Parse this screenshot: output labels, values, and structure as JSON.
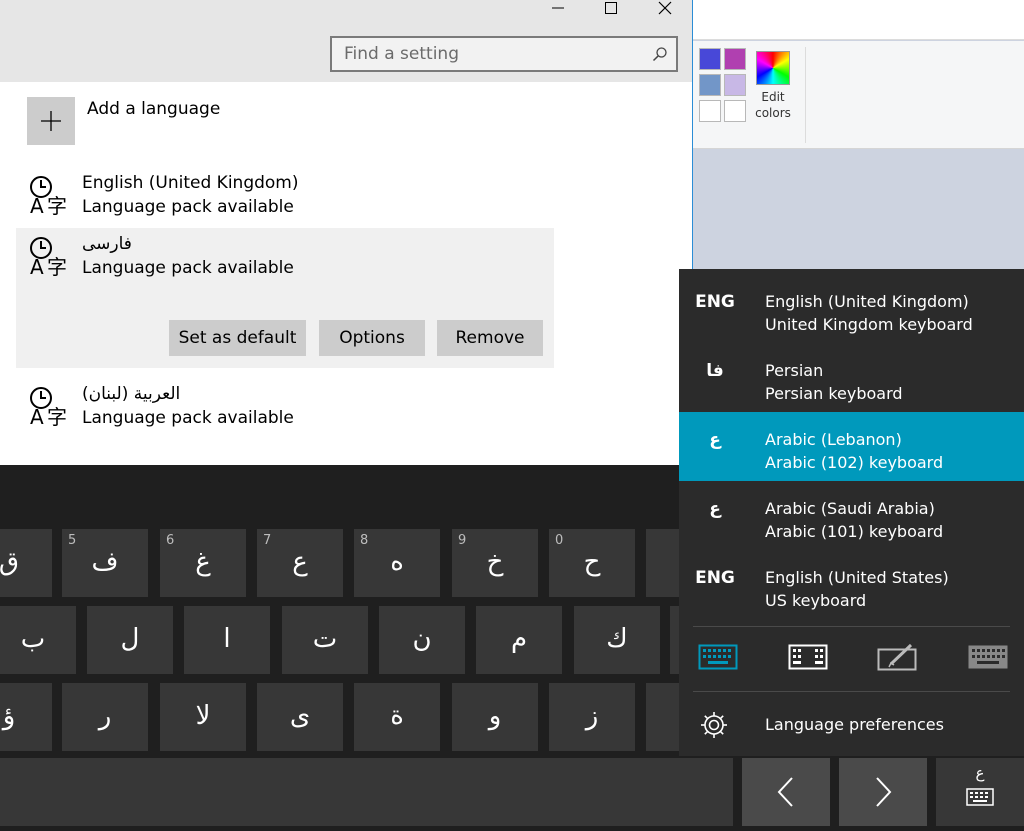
{
  "paint": {
    "edit_colors_label": "Edit colors",
    "swatch_colors": [
      "#4848d8",
      "#b040b0",
      "#7296c8",
      "#c8b8e6",
      "#ffffff",
      "#ffffff"
    ]
  },
  "settings": {
    "search": {
      "placeholder": "Find a setting"
    },
    "add_language_label": "Add a language",
    "languages": [
      {
        "name": "English (United Kingdom)",
        "status": "Language pack available"
      },
      {
        "name": "فارسی",
        "status": "Language pack available"
      },
      {
        "name": "العربية (لبنان)",
        "status": "Language pack available"
      }
    ],
    "buttons": {
      "set_default": "Set as default",
      "options": "Options",
      "remove": "Remove"
    }
  },
  "keyboard": {
    "row1": [
      {
        "ch": "ق",
        "num": ""
      },
      {
        "ch": "ف",
        "num": "5"
      },
      {
        "ch": "غ",
        "num": "6"
      },
      {
        "ch": "ع",
        "num": "7"
      },
      {
        "ch": "ه",
        "num": "8"
      },
      {
        "ch": "خ",
        "num": "9"
      },
      {
        "ch": "ح",
        "num": "0"
      },
      {
        "ch": "",
        "num": ""
      }
    ],
    "row2": [
      "ب",
      "ل",
      "ا",
      "ت",
      "ن",
      "م",
      "ك",
      ""
    ],
    "row3": [
      "ؤ",
      "ر",
      "لا",
      "ى",
      "ة",
      "و",
      "ز",
      ""
    ],
    "lang_key_label": "ع"
  },
  "flyout": {
    "items": [
      {
        "abbr": "ENG",
        "language": "English (United Kingdom)",
        "keyboard": "United Kingdom keyboard"
      },
      {
        "abbr": "فا",
        "language": "Persian",
        "keyboard": "Persian keyboard"
      },
      {
        "abbr": "ع",
        "language": "Arabic (Lebanon)",
        "keyboard": "Arabic (102) keyboard"
      },
      {
        "abbr": "ع",
        "language": "Arabic (Saudi Arabia)",
        "keyboard": "Arabic (101) keyboard"
      },
      {
        "abbr": "ENG",
        "language": "English (United States)",
        "keyboard": "US keyboard"
      }
    ],
    "active_color": "#0099bc",
    "preferences_label": "Language preferences"
  }
}
